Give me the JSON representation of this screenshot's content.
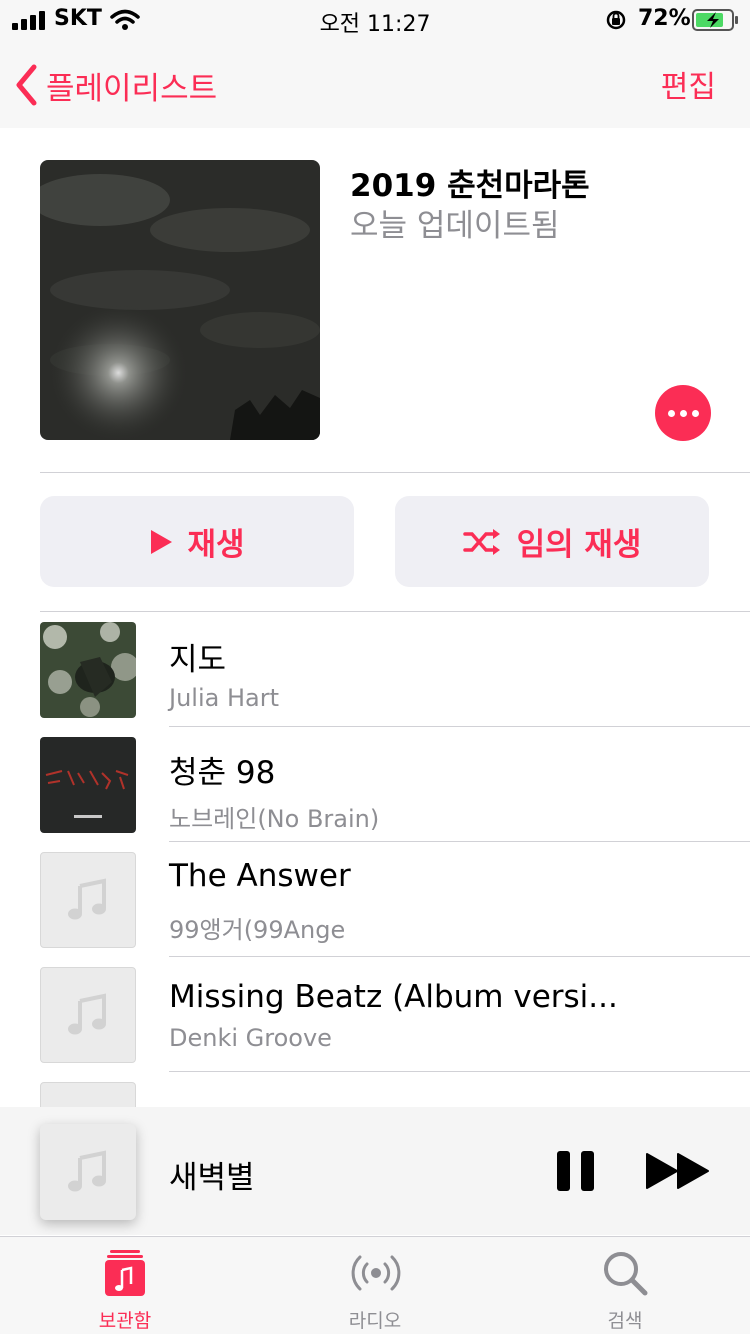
{
  "status": {
    "carrier": "SKT",
    "time": "오전 11:27",
    "battery": "72%"
  },
  "nav": {
    "back_label": "플레이리스트",
    "edit_label": "편집"
  },
  "playlist": {
    "title": "2019 춘천마라톤",
    "subtitle": "오늘 업데이트됨"
  },
  "actions": {
    "play_label": "재생",
    "shuffle_label": "임의 재생"
  },
  "songs": [
    {
      "title": "지도",
      "artist": "Julia Hart"
    },
    {
      "title": "청춘 98",
      "artist": "노브레인(No Brain)"
    },
    {
      "title": "The Answer",
      "artist": "99앵거(99Ange"
    },
    {
      "title": "Missing Beatz (Album versi...",
      "artist": "Denki Groove"
    }
  ],
  "now_playing": {
    "title": "새벽별"
  },
  "tabs": [
    {
      "label": "보관함"
    },
    {
      "label": "라디오"
    },
    {
      "label": "검색"
    }
  ],
  "colors": {
    "accent": "#fb2d55",
    "secondary_text": "#8e8e93"
  }
}
